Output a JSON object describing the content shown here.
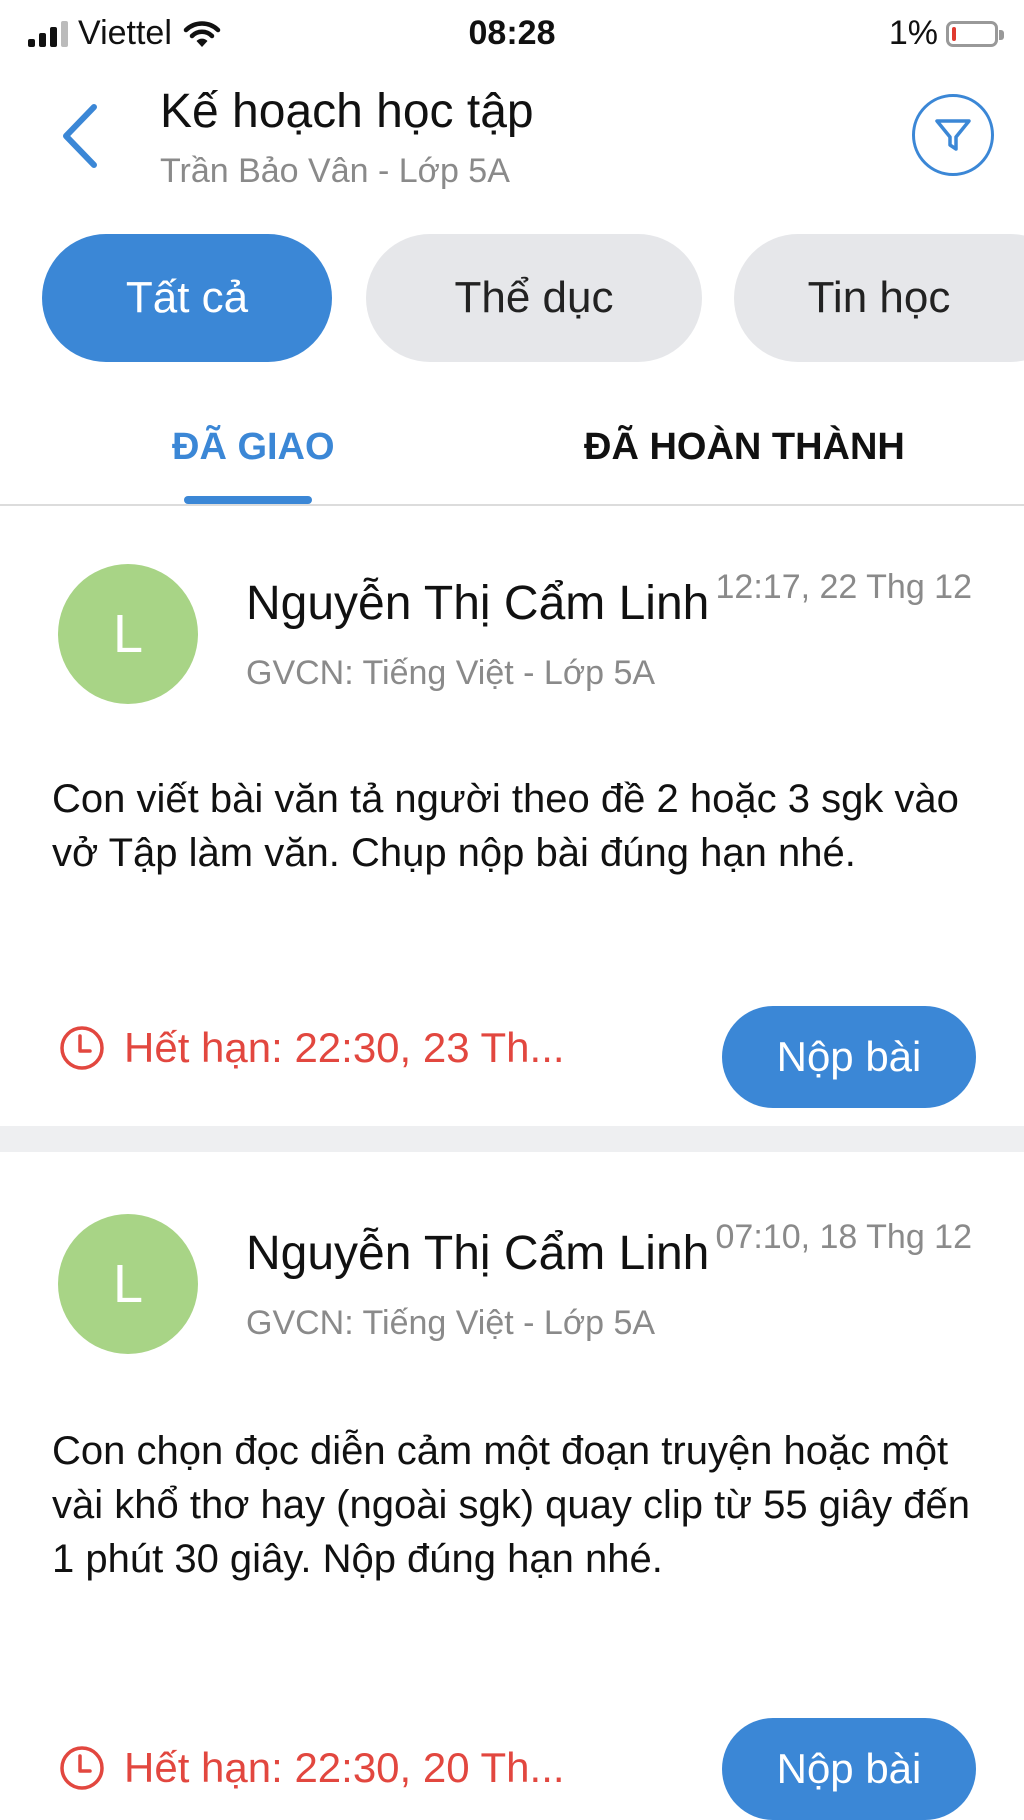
{
  "status_bar": {
    "carrier": "Viettel",
    "time": "08:28",
    "battery_percent": "1%"
  },
  "header": {
    "title": "Kế hoạch học tập",
    "subtitle": "Trần Bảo Vân - Lớp 5A",
    "icons": [
      "chevron-left-icon",
      "filter-icon"
    ]
  },
  "filters": {
    "chips": [
      "Tất cả",
      "Thể dục",
      "Tin học"
    ],
    "selected": "Tất cả"
  },
  "tabs": {
    "items": [
      "ĐÃ GIAO",
      "ĐÃ HOÀN THÀNH"
    ],
    "active": "ĐÃ GIAO"
  },
  "assignments": [
    {
      "avatar_letter": "L",
      "sender": "Nguyễn Thị Cẩm Linh",
      "timestamp": "12:17, 22 Thg 12",
      "role": "GVCN: Tiếng Việt - Lớp 5A",
      "content": "Con viết bài văn tả người theo đề 2 hoặc 3 sgk vào vở Tập làm văn. Chụp nộp bài đúng hạn nhé.",
      "deadline": "Hết hạn: 22:30, 23 Th...",
      "submit_label": "Nộp bài"
    },
    {
      "avatar_letter": "L",
      "sender": "Nguyễn Thị Cẩm Linh",
      "timestamp": "07:10, 18 Thg 12",
      "role": "GVCN: Tiếng Việt - Lớp 5A",
      "content": "Con chọn đọc diễn cảm một đoạn truyện hoặc một vài khổ thơ hay (ngoài sgk) quay clip từ 55 giây đến 1 phút 30 giây. Nộp đúng hạn nhé.",
      "deadline": "Hết hạn: 22:30, 20 Th...",
      "submit_label": "Nộp bài"
    }
  ],
  "colors": {
    "accent": "#3b87d6",
    "deadline": "#e2473f",
    "avatar": "#a8d486",
    "chip_inactive": "#e6e7ea"
  }
}
